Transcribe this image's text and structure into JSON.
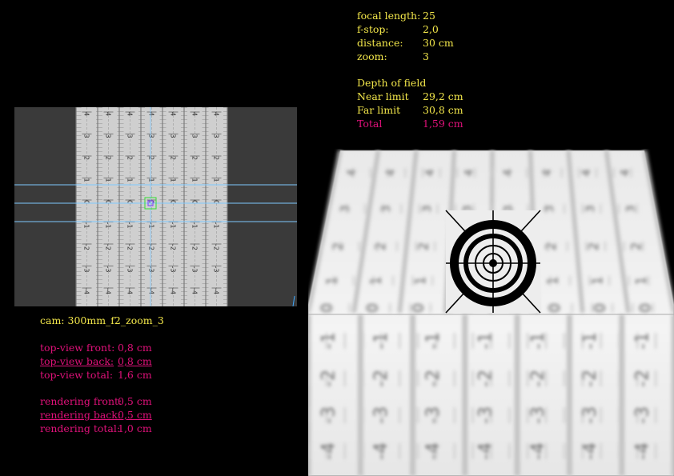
{
  "camera_info": {
    "focal_length": {
      "label": "focal length:",
      "value": "25"
    },
    "fstop": {
      "label": "f-stop:",
      "value": "2,0"
    },
    "distance": {
      "label": "distance:",
      "value": "30 cm"
    },
    "zoom": {
      "label": "zoom:",
      "value": "3"
    }
  },
  "dof": {
    "heading": "Depth of field",
    "near": {
      "label": "Near limit",
      "value": "29,2 cm"
    },
    "far": {
      "label": "Far limit",
      "value": "30,8 cm"
    },
    "total": {
      "label": "Total",
      "value": "1,59 cm"
    }
  },
  "cam_name": "cam: 300mm_f2_zoom_3",
  "topview": {
    "front": {
      "label": "top-view front:",
      "value": "0,8 cm"
    },
    "back": {
      "label": "top-view back:",
      "value": "0,8 cm"
    },
    "total": {
      "label": "top-view total:",
      "value": "1,6 cm"
    }
  },
  "rendering": {
    "front": {
      "label": "rendering front:",
      "value": "0,5 cm"
    },
    "back": {
      "label": "rendering back:",
      "value": "0,5 cm"
    },
    "total": {
      "label": "rendering total:",
      "value": "1,0 cm"
    }
  },
  "ruler_numbers": [
    "4",
    "3",
    "2",
    "1",
    "0",
    "-1",
    "-2",
    "-3",
    "-4"
  ],
  "colors": {
    "yellow": "#f2e64a",
    "pink": "#e0117a",
    "guide": "#7ec8ff",
    "focus": "#33dd33"
  }
}
